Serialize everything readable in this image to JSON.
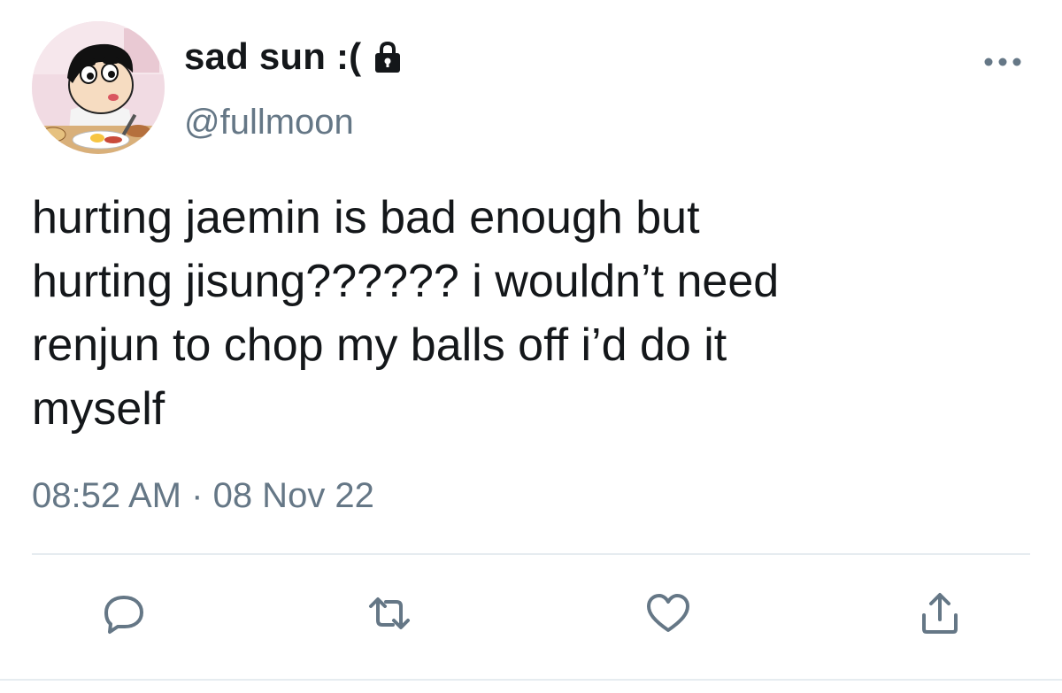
{
  "tweet": {
    "display_name": "sad sun :(",
    "handle": "@fullmoon",
    "text_lines": [
      "hurting jaemin is bad enough but",
      "hurting jisung?????? i wouldn’t need",
      "renjun to chop my balls off i’d do it",
      "myself"
    ],
    "time": "08:52 AM",
    "separator": "·",
    "date": "08 Nov 22"
  },
  "icons": {
    "protected": "lock-icon",
    "more": "more-icon",
    "reply": "reply-icon",
    "retweet": "retweet-icon",
    "like": "heart-icon",
    "share": "share-icon"
  },
  "colors": {
    "text": "#14171a",
    "secondary": "#657786",
    "icon": "#657786",
    "divider": "#e6ecf0"
  }
}
